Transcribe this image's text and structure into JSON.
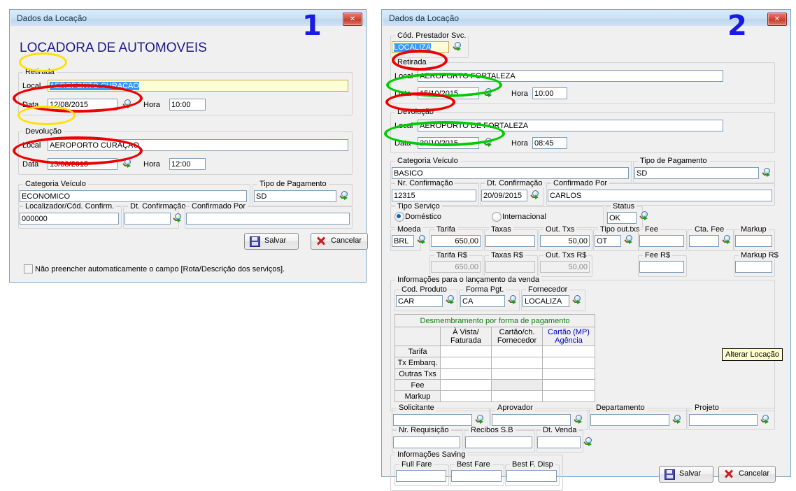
{
  "dialog1": {
    "title": "Dados da Locação",
    "marker": "1",
    "close_icon": "close-icon",
    "heading": "LOCADORA DE AUTOMOVEIS",
    "retirada": {
      "group_label": "Retirada",
      "local_label": "Local",
      "local_value": "AEROPORTO CURAÇAO",
      "data_label": "Data",
      "data_value": "12/08/2015",
      "hora_label": "Hora",
      "hora_value": "10:00"
    },
    "devolucao": {
      "group_label": "Devolução",
      "local_label": "Local",
      "local_value": "AEROPORTO CURAÇAO",
      "data_label": "Data",
      "data_value": "15/08/2015",
      "hora_label": "Hora",
      "hora_value": "12:00"
    },
    "categoria_label": "Categoria Veículo",
    "categoria_value": "ECONOMICO",
    "tipo_pagto_label": "Tipo de Pagamento",
    "tipo_pagto_value": "SD",
    "localizador_label": "Localizador/Cód. Confirm.",
    "localizador_value": "000000",
    "dt_confirmacao_label": "Dt. Confirmação",
    "dt_confirmacao_value": "",
    "confirmado_label": "Confirmado Por",
    "confirmado_value": "",
    "save_label": "Salvar",
    "cancel_label": "Cancelar",
    "checkbox_label": "Não preencher automaticamente o campo [Rota/Descrição dos serviços]."
  },
  "dialog2": {
    "title": "Dados da Locação",
    "marker": "2",
    "cod_prestador_label": "Cód. Prestador Svc.",
    "cod_prestador_value": "LOCALIZA",
    "retirada": {
      "group_label": "Retirada",
      "local_label": "Local",
      "local_value": "AEROPORTO FORTALEZA",
      "data_label": "Data",
      "data_value": "15/10/2015",
      "hora_label": "Hora",
      "hora_value": "10:00"
    },
    "devolucao": {
      "group_label": "Devolução",
      "local_label": "Local",
      "local_value": "AEROPORTO DE FORTALEZA",
      "data_label": "Data",
      "data_value": "20/10/2015",
      "hora_label": "Hora",
      "hora_value": "08:45"
    },
    "categoria_label": "Categoria Veículo",
    "categoria_value": "BASICO",
    "tipo_pagto_label": "Tipo de Pagamento",
    "tipo_pagto_value": "SD",
    "nr_confirmacao_label": "Nr. Confirmação",
    "nr_confirmacao_value": "12315",
    "dt_confirmacao_label": "Dt. Confirmação",
    "dt_confirmacao_value": "20/09/2015",
    "confirmado_label": "Confirmado Por",
    "confirmado_value": "CARLOS",
    "tipo_servico_label": "Tipo Serviço",
    "radio_domestico": "Doméstico",
    "radio_internacional": "Internacional",
    "status_label": "Status",
    "status_value": "OK",
    "moeda_label": "Moeda",
    "moeda_value": "BRL",
    "tarifa_label": "Tarifa",
    "tarifa_value": "650,00",
    "taxas_label": "Taxas",
    "taxas_value": "",
    "out_txs_label": "Out. Txs",
    "out_txs_value": "50,00",
    "tipo_out_txs_label": "Tipo out.txs",
    "tipo_out_txs_value": "OT",
    "fee_label": "Fee",
    "fee_value": "",
    "cta_fee_label": "Cta. Fee",
    "cta_fee_value": "",
    "markup_label": "Markup",
    "markup_value": "",
    "tarifa_rs_label": "Tarifa R$",
    "tarifa_rs_value": "650,00",
    "taxas_rs_label": "Taxas R$",
    "taxas_rs_value": "",
    "out_txs_rs_label": "Out. Txs R$",
    "out_txs_rs_value": "50,00",
    "fee_rs_label": "Fee R$",
    "fee_rs_value": "",
    "markup_rs_label": "Markup R$",
    "markup_rs_value": "",
    "info_venda_label": "Informações para o lançamento da venda",
    "cod_produto_label": "Cod. Produto",
    "cod_produto_value": "CAR",
    "forma_pgt_label": "Forma Pgt.",
    "forma_pgt_value": "CA",
    "fornecedor_label": "Fornecedor",
    "fornecedor_value": "LOCALIZA",
    "table": {
      "banner": "Desmembramento por forma de pagamento",
      "columns": [
        "",
        "À Vista/\nFaturada",
        "Cartão/ch.\nFornecedor",
        "Cartão (MP)\nAgência"
      ],
      "col1_line1": "À Vista/",
      "col1_line2": "Faturada",
      "col2_line1": "Cartão/ch.",
      "col2_line2": "Fornecedor",
      "col3_line1": "Cartão (MP)",
      "col3_line2": "Agência",
      "rows": [
        {
          "label": "Tarifa",
          "values": [
            "",
            "",
            ""
          ]
        },
        {
          "label": "Tx Embarq.",
          "values": [
            "",
            "",
            ""
          ]
        },
        {
          "label": "Outras Txs",
          "values": [
            "",
            "",
            ""
          ]
        },
        {
          "label": "Fee",
          "values": [
            "",
            "",
            ""
          ]
        },
        {
          "label": "Markup",
          "values": [
            "",
            "",
            ""
          ]
        }
      ]
    },
    "solicitante_label": "Solicitante",
    "solicitante_value": "",
    "aprovador_label": "Aprovador",
    "aprovador_value": "",
    "departamento_label": "Departamento",
    "departamento_value": "",
    "projeto_label": "Projeto",
    "projeto_value": "",
    "nr_requisicao_label": "Nr. Requisição",
    "nr_requisicao_value": "",
    "recibos_label": "Recibos S.B",
    "recibos_value": "",
    "dt_venda_label": "Dt. Venda",
    "dt_venda_value": "",
    "info_saving_label": "Informações Saving",
    "full_fare_label": "Full Fare",
    "full_fare_value": "",
    "best_fare_label": "Best Fare",
    "best_fare_value": "",
    "best_f_disp_label": "Best F. Disp",
    "best_f_disp_value": "",
    "save_label": "Salvar",
    "cancel_label": "Cancelar",
    "tooltip": "Alterar Locação"
  },
  "colors": {
    "accent_blue": "#1a1ae0",
    "annotation_red": "#ee0000",
    "annotation_yellow": "#ffe000",
    "annotation_green": "#00cc00",
    "heading_blue": "#1a1a8c",
    "table_green": "#108010"
  }
}
